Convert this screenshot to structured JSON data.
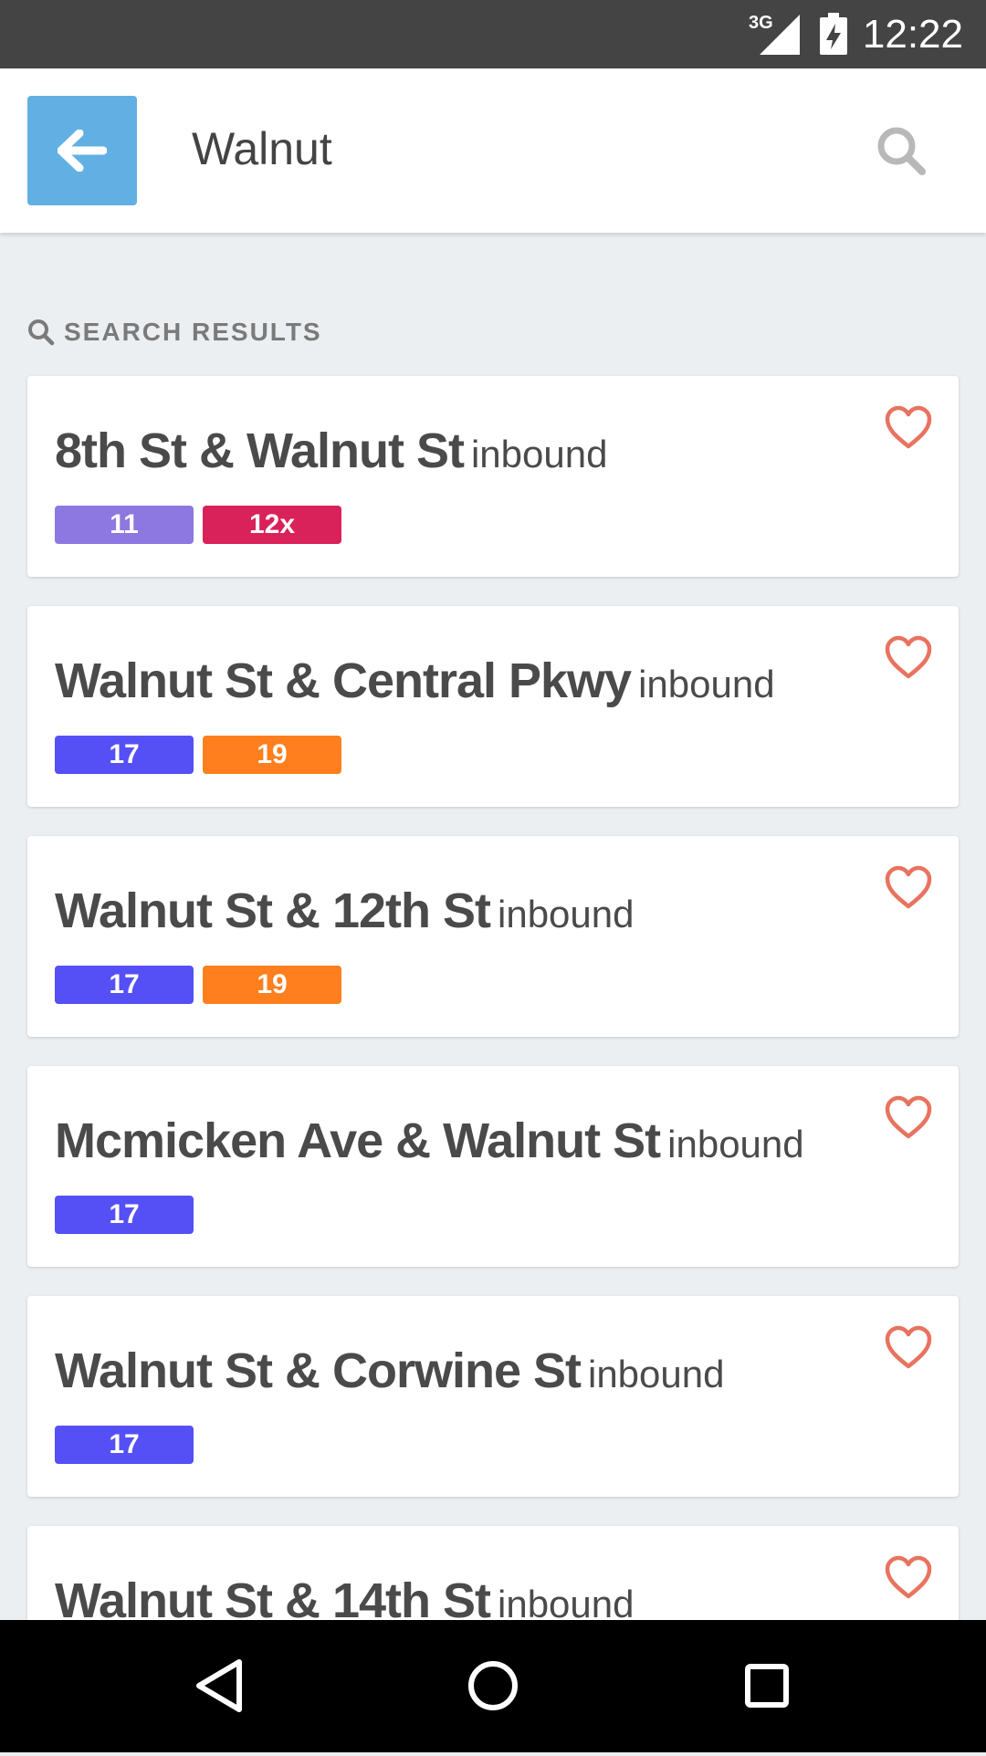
{
  "status_bar": {
    "network": "3G",
    "time": "12:22"
  },
  "app_bar": {
    "back_icon": "arrow-left-icon",
    "query": "Walnut",
    "search_icon": "search-icon"
  },
  "section": {
    "icon": "search-icon",
    "label": "SEARCH RESULTS"
  },
  "colors": {
    "accent": "#62b0e3",
    "favorite": "#e8735f",
    "route_11": "#8c78e0",
    "route_12x": "#d9215a",
    "route_17": "#5550f5",
    "route_19": "#ff7f1e"
  },
  "results": [
    {
      "name": "8th St & Walnut St",
      "direction": "inbound",
      "routes": [
        {
          "label": "11",
          "color": "#8c78e0"
        },
        {
          "label": "12x",
          "color": "#d9215a"
        }
      ]
    },
    {
      "name": "Walnut St & Central Pkwy",
      "direction": "inbound",
      "routes": [
        {
          "label": "17",
          "color": "#5550f5"
        },
        {
          "label": "19",
          "color": "#ff7f1e"
        }
      ]
    },
    {
      "name": "Walnut St & 12th St",
      "direction": "inbound",
      "routes": [
        {
          "label": "17",
          "color": "#5550f5"
        },
        {
          "label": "19",
          "color": "#ff7f1e"
        }
      ]
    },
    {
      "name": "Mcmicken Ave & Walnut St",
      "direction": "inbound",
      "routes": [
        {
          "label": "17",
          "color": "#5550f5"
        }
      ]
    },
    {
      "name": "Walnut St & Corwine St",
      "direction": "inbound",
      "routes": [
        {
          "label": "17",
          "color": "#5550f5"
        }
      ]
    },
    {
      "name": "Walnut St & 14th St",
      "direction": "inbound",
      "routes": []
    }
  ],
  "nav_bar": {
    "back_icon": "triangle-back-icon",
    "home_icon": "circle-home-icon",
    "recents_icon": "square-recents-icon"
  }
}
